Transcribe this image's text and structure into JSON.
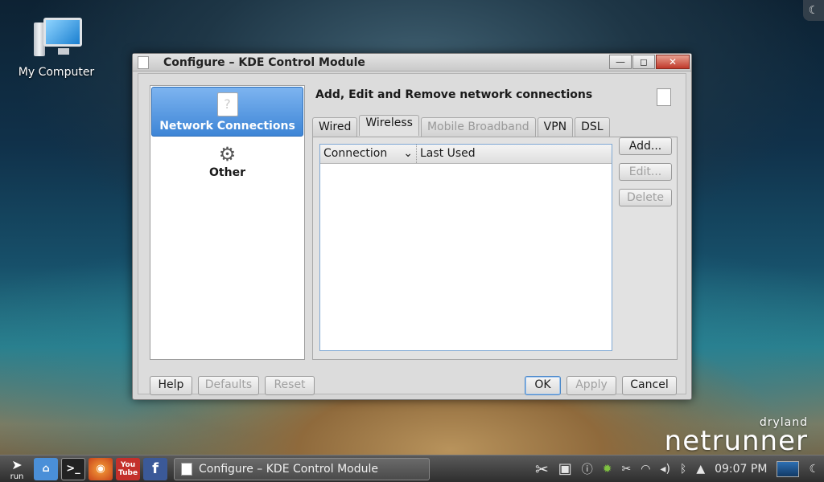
{
  "desktop": {
    "icon_label": "My Computer",
    "brand_small": "dryland",
    "brand_big": "netrunner"
  },
  "window": {
    "title": "Configure – KDE Control Module",
    "buttons": {
      "minimize": "—",
      "maximize": "◻",
      "close": "✕"
    }
  },
  "sidebar": {
    "items": [
      {
        "label": "Network Connections",
        "icon": "document-icon"
      },
      {
        "label": "Other",
        "icon": "tools-icon"
      }
    ]
  },
  "main": {
    "header": "Add, Edit and Remove network connections",
    "tabs": [
      {
        "label": "Wired",
        "state": "normal"
      },
      {
        "label": "Wireless",
        "state": "active"
      },
      {
        "label": "Mobile Broadband",
        "state": "disabled"
      },
      {
        "label": "VPN",
        "state": "normal"
      },
      {
        "label": "DSL",
        "state": "normal"
      }
    ],
    "list": {
      "columns": [
        "Connection",
        "Last Used"
      ],
      "rows": []
    },
    "actions": {
      "add": "Add...",
      "edit": "Edit...",
      "delete": "Delete"
    }
  },
  "footer": {
    "help": "Help",
    "defaults": "Defaults",
    "reset": "Reset",
    "ok": "OK",
    "apply": "Apply",
    "cancel": "Cancel"
  },
  "taskbar": {
    "start_label": "run",
    "youtube_label": "You Tube",
    "task_title": "Configure – KDE Control Module",
    "clock": "09:07 PM"
  },
  "colors": {
    "accent": "#3d85d6",
    "window_bg": "#d6d6d6",
    "close_button": "#c0392b"
  }
}
